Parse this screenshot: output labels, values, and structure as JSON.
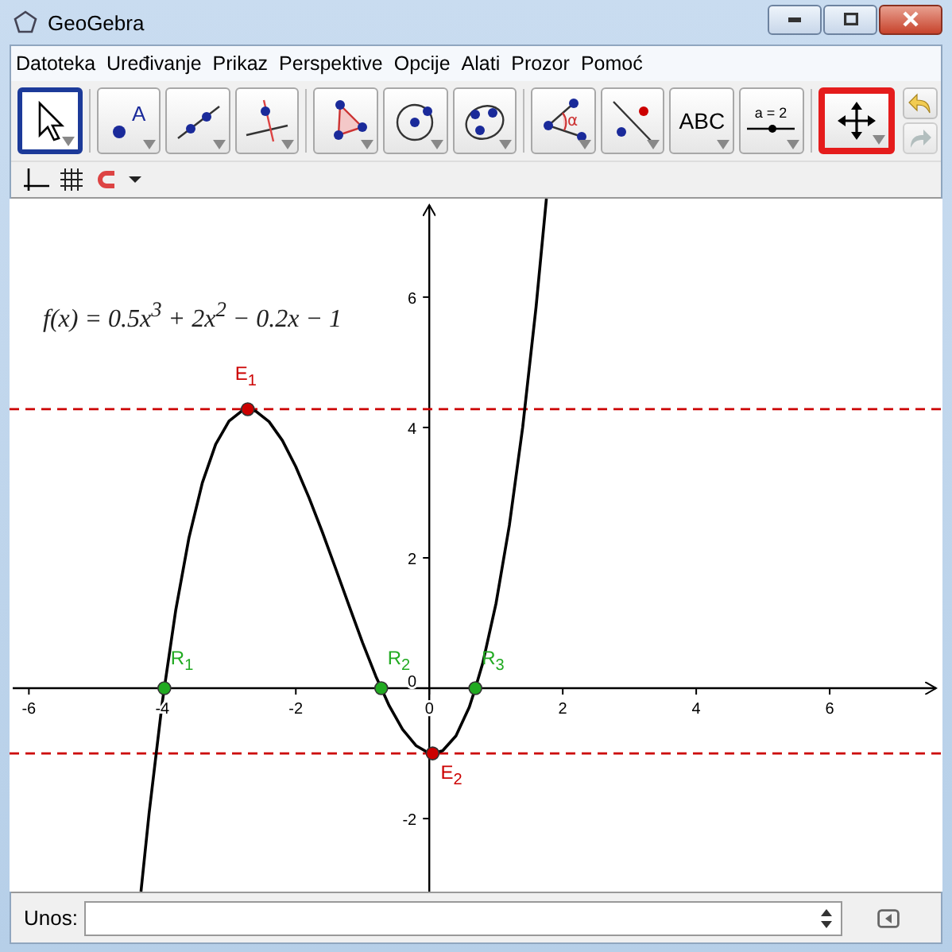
{
  "window": {
    "title": "GeoGebra"
  },
  "menu": [
    "Datoteka",
    "Uređivanje",
    "Prikaz",
    "Perspektive",
    "Opcije",
    "Alati",
    "Prozor",
    "Pomoć"
  ],
  "toolbar": {
    "groups": [
      [
        {
          "kind": "pointer",
          "selected": true,
          "highlighted": false
        }
      ],
      [
        {
          "kind": "point",
          "text": "A",
          "selected": false,
          "highlighted": false
        },
        {
          "kind": "line",
          "selected": false,
          "highlighted": false
        },
        {
          "kind": "perpendicular",
          "selected": false,
          "highlighted": false
        }
      ],
      [
        {
          "kind": "polygon",
          "selected": false,
          "highlighted": false
        },
        {
          "kind": "circle",
          "selected": false,
          "highlighted": false
        },
        {
          "kind": "conic",
          "selected": false,
          "highlighted": false
        }
      ],
      [
        {
          "kind": "angle",
          "text": "α",
          "selected": false,
          "highlighted": false
        },
        {
          "kind": "reflect",
          "selected": false,
          "highlighted": false
        },
        {
          "kind": "text",
          "text": "ABC",
          "selected": false,
          "highlighted": false
        },
        {
          "kind": "slider",
          "text": "a = 2",
          "selected": false,
          "highlighted": false
        }
      ],
      [
        {
          "kind": "move",
          "selected": false,
          "highlighted": true
        }
      ]
    ],
    "undo": {
      "disabled": false
    },
    "redo": {
      "disabled": true
    }
  },
  "graphics": {
    "formula": "f(x) = 0.5x$^{3}$ + 2x$^{2}$ − 0.2x − 1",
    "chart_data": {
      "type": "line",
      "x": [
        -4.32,
        -4.2,
        -4.0,
        -3.97,
        -3.8,
        -3.6,
        -3.4,
        -3.2,
        -3.0,
        -2.8,
        -2.72,
        -2.6,
        -2.4,
        -2.2,
        -2.0,
        -1.8,
        -1.6,
        -1.4,
        -1.2,
        -1.0,
        -0.8,
        -0.72,
        -0.6,
        -0.4,
        -0.2,
        0,
        0.05,
        0.2,
        0.4,
        0.6,
        0.69,
        0.8,
        1.0,
        1.2,
        1.4,
        1.6,
        1.755
      ],
      "series": [
        {
          "color": "#000000",
          "values": [
            -3.12,
            -1.92,
            -0.2,
            0,
            1.2,
            2.31,
            3.15,
            3.74,
            4.1,
            4.26,
            4.28,
            4.25,
            4.09,
            3.8,
            3.4,
            2.92,
            2.39,
            1.83,
            1.26,
            0.7,
            0.18,
            0,
            -0.27,
            -0.63,
            -0.88,
            -1,
            -1.0,
            -0.96,
            -0.73,
            -0.29,
            0,
            0.38,
            1.3,
            2.5,
            4.01,
            5.85,
            7.51
          ]
        },
        {
          "color": "#cc0000",
          "marker": "circle",
          "values": [
            null,
            null,
            null,
            null,
            null,
            null,
            null,
            null,
            null,
            null,
            4.28,
            null,
            null,
            null,
            null,
            null,
            null,
            null,
            null,
            null,
            null,
            null,
            null,
            null,
            null,
            null,
            -1.0,
            null,
            null,
            null,
            null,
            null,
            null,
            null,
            null,
            null,
            null
          ]
        },
        {
          "color": "#22aa22",
          "marker": "circle",
          "values": [
            null,
            null,
            null,
            0,
            null,
            null,
            null,
            null,
            null,
            null,
            null,
            null,
            null,
            null,
            null,
            null,
            null,
            null,
            null,
            null,
            null,
            0,
            null,
            null,
            null,
            null,
            null,
            null,
            null,
            null,
            0,
            null,
            null,
            null,
            null,
            null,
            null
          ]
        }
      ],
      "xlim": [
        -6.29,
        7.69
      ],
      "ylim": [
        -3.12,
        7.51
      ],
      "xticks": [
        -6,
        -4,
        -2,
        0,
        2,
        4,
        6
      ],
      "yticks": [
        -2,
        0,
        2,
        4,
        6
      ],
      "ref_lines": [
        {
          "axis": "y",
          "value": 4.28,
          "color": "#cc0000"
        },
        {
          "axis": "y",
          "value": -1.0,
          "color": "#cc0000"
        }
      ],
      "annotations": [
        {
          "x": -2.72,
          "y": 4.28,
          "text": "E$_{1}$"
        },
        {
          "x": 0.05,
          "y": -1.0,
          "text": "E$_{2}$"
        },
        {
          "x": -3.97,
          "y": 0,
          "text": "R$_{1}$"
        },
        {
          "x": -0.72,
          "y": 0,
          "text": "R$_{2}$"
        },
        {
          "x": 0.69,
          "y": 0,
          "text": "R$_{3}$"
        }
      ]
    }
  },
  "input_bar": {
    "label": "Unos:"
  }
}
